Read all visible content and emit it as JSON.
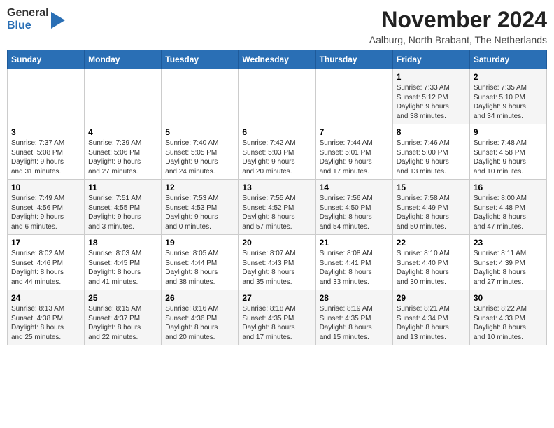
{
  "header": {
    "logo_general": "General",
    "logo_blue": "Blue",
    "month_title": "November 2024",
    "subtitle": "Aalburg, North Brabant, The Netherlands"
  },
  "weekdays": [
    "Sunday",
    "Monday",
    "Tuesday",
    "Wednesday",
    "Thursday",
    "Friday",
    "Saturday"
  ],
  "rows": [
    [
      {
        "day": "",
        "info": ""
      },
      {
        "day": "",
        "info": ""
      },
      {
        "day": "",
        "info": ""
      },
      {
        "day": "",
        "info": ""
      },
      {
        "day": "",
        "info": ""
      },
      {
        "day": "1",
        "info": "Sunrise: 7:33 AM\nSunset: 5:12 PM\nDaylight: 9 hours\nand 38 minutes."
      },
      {
        "day": "2",
        "info": "Sunrise: 7:35 AM\nSunset: 5:10 PM\nDaylight: 9 hours\nand 34 minutes."
      }
    ],
    [
      {
        "day": "3",
        "info": "Sunrise: 7:37 AM\nSunset: 5:08 PM\nDaylight: 9 hours\nand 31 minutes."
      },
      {
        "day": "4",
        "info": "Sunrise: 7:39 AM\nSunset: 5:06 PM\nDaylight: 9 hours\nand 27 minutes."
      },
      {
        "day": "5",
        "info": "Sunrise: 7:40 AM\nSunset: 5:05 PM\nDaylight: 9 hours\nand 24 minutes."
      },
      {
        "day": "6",
        "info": "Sunrise: 7:42 AM\nSunset: 5:03 PM\nDaylight: 9 hours\nand 20 minutes."
      },
      {
        "day": "7",
        "info": "Sunrise: 7:44 AM\nSunset: 5:01 PM\nDaylight: 9 hours\nand 17 minutes."
      },
      {
        "day": "8",
        "info": "Sunrise: 7:46 AM\nSunset: 5:00 PM\nDaylight: 9 hours\nand 13 minutes."
      },
      {
        "day": "9",
        "info": "Sunrise: 7:48 AM\nSunset: 4:58 PM\nDaylight: 9 hours\nand 10 minutes."
      }
    ],
    [
      {
        "day": "10",
        "info": "Sunrise: 7:49 AM\nSunset: 4:56 PM\nDaylight: 9 hours\nand 6 minutes."
      },
      {
        "day": "11",
        "info": "Sunrise: 7:51 AM\nSunset: 4:55 PM\nDaylight: 9 hours\nand 3 minutes."
      },
      {
        "day": "12",
        "info": "Sunrise: 7:53 AM\nSunset: 4:53 PM\nDaylight: 9 hours\nand 0 minutes."
      },
      {
        "day": "13",
        "info": "Sunrise: 7:55 AM\nSunset: 4:52 PM\nDaylight: 8 hours\nand 57 minutes."
      },
      {
        "day": "14",
        "info": "Sunrise: 7:56 AM\nSunset: 4:50 PM\nDaylight: 8 hours\nand 54 minutes."
      },
      {
        "day": "15",
        "info": "Sunrise: 7:58 AM\nSunset: 4:49 PM\nDaylight: 8 hours\nand 50 minutes."
      },
      {
        "day": "16",
        "info": "Sunrise: 8:00 AM\nSunset: 4:48 PM\nDaylight: 8 hours\nand 47 minutes."
      }
    ],
    [
      {
        "day": "17",
        "info": "Sunrise: 8:02 AM\nSunset: 4:46 PM\nDaylight: 8 hours\nand 44 minutes."
      },
      {
        "day": "18",
        "info": "Sunrise: 8:03 AM\nSunset: 4:45 PM\nDaylight: 8 hours\nand 41 minutes."
      },
      {
        "day": "19",
        "info": "Sunrise: 8:05 AM\nSunset: 4:44 PM\nDaylight: 8 hours\nand 38 minutes."
      },
      {
        "day": "20",
        "info": "Sunrise: 8:07 AM\nSunset: 4:43 PM\nDaylight: 8 hours\nand 35 minutes."
      },
      {
        "day": "21",
        "info": "Sunrise: 8:08 AM\nSunset: 4:41 PM\nDaylight: 8 hours\nand 33 minutes."
      },
      {
        "day": "22",
        "info": "Sunrise: 8:10 AM\nSunset: 4:40 PM\nDaylight: 8 hours\nand 30 minutes."
      },
      {
        "day": "23",
        "info": "Sunrise: 8:11 AM\nSunset: 4:39 PM\nDaylight: 8 hours\nand 27 minutes."
      }
    ],
    [
      {
        "day": "24",
        "info": "Sunrise: 8:13 AM\nSunset: 4:38 PM\nDaylight: 8 hours\nand 25 minutes."
      },
      {
        "day": "25",
        "info": "Sunrise: 8:15 AM\nSunset: 4:37 PM\nDaylight: 8 hours\nand 22 minutes."
      },
      {
        "day": "26",
        "info": "Sunrise: 8:16 AM\nSunset: 4:36 PM\nDaylight: 8 hours\nand 20 minutes."
      },
      {
        "day": "27",
        "info": "Sunrise: 8:18 AM\nSunset: 4:35 PM\nDaylight: 8 hours\nand 17 minutes."
      },
      {
        "day": "28",
        "info": "Sunrise: 8:19 AM\nSunset: 4:35 PM\nDaylight: 8 hours\nand 15 minutes."
      },
      {
        "day": "29",
        "info": "Sunrise: 8:21 AM\nSunset: 4:34 PM\nDaylight: 8 hours\nand 13 minutes."
      },
      {
        "day": "30",
        "info": "Sunrise: 8:22 AM\nSunset: 4:33 PM\nDaylight: 8 hours\nand 10 minutes."
      }
    ]
  ]
}
